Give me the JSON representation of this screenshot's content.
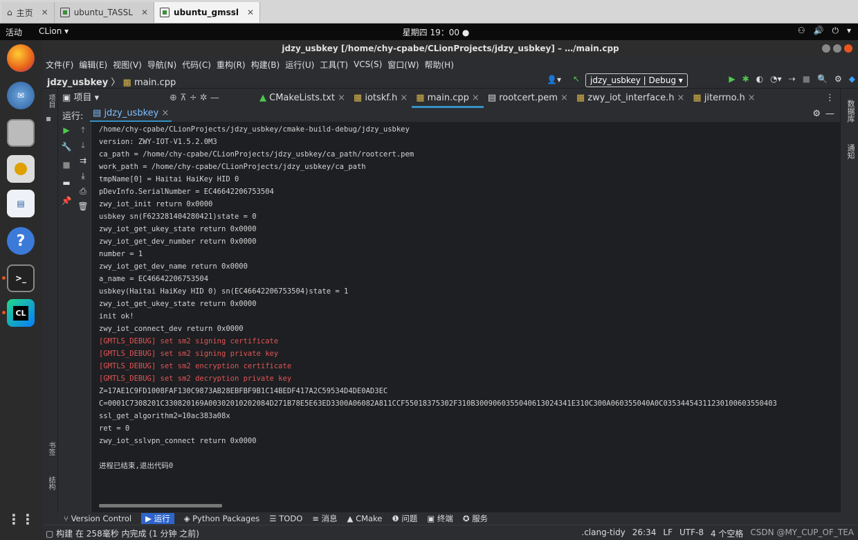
{
  "vm_tabs": [
    {
      "label": "主页",
      "icon": "home-icon"
    },
    {
      "label": "ubuntu_TASSL",
      "icon": "vm-icon"
    },
    {
      "label": "ubuntu_gmssl",
      "icon": "vm-icon",
      "active": true
    }
  ],
  "topbar": {
    "activities": "活动",
    "app": "CLion ▾",
    "clock": "星期四 19：00 ●"
  },
  "window": {
    "title": "jdzy_usbkey [/home/chy-cpabe/CLionProjects/jdzy_usbkey] – …/main.cpp"
  },
  "menu": [
    "文件(F)",
    "编辑(E)",
    "视图(V)",
    "导航(N)",
    "代码(C)",
    "重构(R)",
    "构建(B)",
    "运行(U)",
    "工具(T)",
    "VCS(S)",
    "窗口(W)",
    "帮助(H)"
  ],
  "nav": {
    "project": "jdzy_usbkey",
    "file": "main.cpp",
    "run_config": "jdzy_usbkey | Debug ▾"
  },
  "project_tool": "项目",
  "editor_tabs": [
    {
      "label": "CMakeLists.txt"
    },
    {
      "label": "iotskf.h"
    },
    {
      "label": "main.cpp",
      "active": true
    },
    {
      "label": "rootcert.pem"
    },
    {
      "label": "zwy_iot_interface.h"
    },
    {
      "label": "jiterrno.h"
    }
  ],
  "run_panel": {
    "label": "运行:",
    "tab": "jdzy_usbkey"
  },
  "console_lines": [
    {
      "text": "/home/chy-cpabe/CLionProjects/jdzy_usbkey/cmake-build-debug/jdzy_usbkey",
      "type": "normal"
    },
    {
      "text": "version: ZWY-IOT-V1.5.2.0M3",
      "type": "normal"
    },
    {
      "text": "ca_path = /home/chy-cpabe/CLionProjects/jdzy_usbkey/ca_path/rootcert.pem",
      "type": "normal"
    },
    {
      "text": "work_path = /home/chy-cpabe/CLionProjects/jdzy_usbkey/ca_path",
      "type": "normal"
    },
    {
      "text": "tmpName[0] = Haitai HaiKey HID 0",
      "type": "normal"
    },
    {
      "text": "pDevInfo.SerialNumber = EC46642206753504",
      "type": "normal"
    },
    {
      "text": "zwy_iot_init return 0x0000",
      "type": "normal"
    },
    {
      "text": "usbkey sn(F623281404280421)state = 0",
      "type": "normal"
    },
    {
      "text": "zwy_iot_get_ukey_state return 0x0000",
      "type": "normal"
    },
    {
      "text": "zwy_iot_get_dev_number return 0x0000",
      "type": "normal"
    },
    {
      "text": "number = 1",
      "type": "normal"
    },
    {
      "text": "zwy_iot_get_dev_name return 0x0000",
      "type": "normal"
    },
    {
      "text": "a_name = EC46642206753504",
      "type": "normal"
    },
    {
      "text": "usbkey(Haitai HaiKey HID 0) sn(EC46642206753504)state = 1",
      "type": "normal"
    },
    {
      "text": "zwy_iot_get_ukey_state return 0x0000",
      "type": "normal"
    },
    {
      "text": "init ok!",
      "type": "normal"
    },
    {
      "text": "zwy_iot_connect_dev return 0x0000",
      "type": "normal"
    },
    {
      "text": "[GMTLS_DEBUG] set sm2 signing certificate",
      "type": "err"
    },
    {
      "text": "[GMTLS_DEBUG] set sm2 signing private key",
      "type": "err"
    },
    {
      "text": "[GMTLS_DEBUG] set sm2 encryption certificate",
      "type": "err"
    },
    {
      "text": "[GMTLS_DEBUG] set sm2 decryption private key",
      "type": "err"
    },
    {
      "text": "Z=17AE1C9FD1008FAF130C9873AB28EBFBF9B1C14BEDF417A2C59534D4DE0AD3EC",
      "type": "normal"
    },
    {
      "text": "C=0001C7308201C330820169A00302010202084D271B78E5E63ED3300A06082A811CCF55018375302F310B3009060355040613024341E310C300A060355040A0C03534454311230100603550403",
      "type": "normal"
    },
    {
      "text": "ssl_get_algorithm2=10ac383a08x",
      "type": "normal"
    },
    {
      "text": "ret = 0",
      "type": "normal"
    },
    {
      "text": "zwy_iot_sslvpn_connect return 0x0000",
      "type": "normal"
    },
    {
      "text": "",
      "type": "normal"
    },
    {
      "text": "进程已结束,退出代码0",
      "type": "normal"
    }
  ],
  "bottom_tools": [
    "Version Control",
    "运行",
    "Python Packages",
    "TODO",
    "消息",
    "CMake",
    "问题",
    "终端",
    "服务"
  ],
  "right_strip": [
    "数据库",
    "通知"
  ],
  "left_strip_bottom": [
    "书签",
    "结构"
  ],
  "status": {
    "message": "构建 在 258毫秒 内完成 (1 分钟 之前)",
    "right_items": [
      ".clang-tidy",
      "26:34",
      "LF",
      "UTF-8",
      "4 个空格"
    ],
    "watermark": "CSDN @MY_CUP_OF_TEA"
  },
  "colors": {
    "accent": "#3592c4",
    "error": "#e05555",
    "run_green": "#4ec94e"
  }
}
